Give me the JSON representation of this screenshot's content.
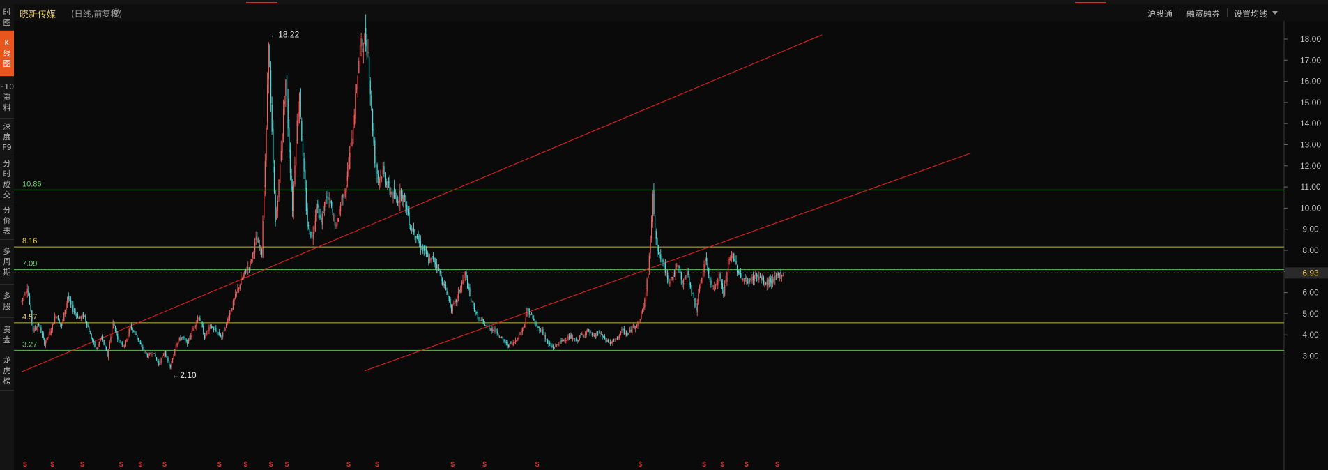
{
  "sidebar": {
    "items": [
      {
        "label": "分时图",
        "chars": [
          "时",
          "图"
        ]
      },
      {
        "label": "K线图",
        "chars": [
          "K",
          "线",
          "图"
        ],
        "active": true
      },
      {
        "label": "F10资料",
        "chars": [
          "F10",
          "资",
          "料"
        ]
      },
      {
        "label": "深度F9",
        "chars": [
          "深",
          "度",
          "F9"
        ]
      },
      {
        "label": "分时成交",
        "chars": [
          "分",
          "时",
          "成",
          "交"
        ]
      },
      {
        "label": "分价表",
        "chars": [
          "分",
          "价",
          "表"
        ]
      },
      {
        "label": "多周期",
        "chars": [
          "多",
          "周",
          "期"
        ]
      },
      {
        "label": "多股",
        "chars": [
          "多",
          "股"
        ]
      },
      {
        "label": "资金",
        "chars": [
          "资",
          "金"
        ]
      },
      {
        "label": "龙虎榜",
        "chars": [
          "龙",
          "虎",
          "榜"
        ]
      }
    ]
  },
  "header": {
    "title": "晓新传媒",
    "subtitle": "(日线,前复权)",
    "buttons": [
      "沪股通",
      "融资融券",
      "设置均线"
    ],
    "gear_icon": "gear-icon",
    "dropdown_icon": "caret-down-icon"
  },
  "colors": {
    "up": "#f25b5b",
    "down": "#4fd6d6",
    "trendline": "#e02020",
    "level_green": "#6fd36f",
    "level_yellow": "#e8d24a",
    "price_tag": "#e8c040",
    "axis_text": "#bfbfbf"
  },
  "chart_data": {
    "type": "candlestick",
    "title": "晓新传媒",
    "y_ticks": [
      "18.00",
      "17.00",
      "16.00",
      "15.00",
      "14.00",
      "13.00",
      "12.00",
      "11.00",
      "10.00",
      "9.00",
      "8.00",
      "7.00",
      "6.00",
      "5.00",
      "4.00",
      "3.00"
    ],
    "ylim": [
      2.5,
      18.5
    ],
    "current_price": "6.93",
    "high_label": "18.22",
    "low_label": "2.10",
    "levels": [
      {
        "value": 10.86,
        "label": "10.86",
        "color": "green"
      },
      {
        "value": 8.16,
        "label": "8.16",
        "color": "yellow"
      },
      {
        "value": 7.09,
        "label": "7.09",
        "color": "green"
      },
      {
        "value": 4.57,
        "label": "4.57",
        "color": "yellow"
      },
      {
        "value": 3.27,
        "label": "3.27",
        "color": "green"
      }
    ],
    "trendlines": [
      {
        "from_index": 0,
        "from_price": 2.25,
        "to_index": 700,
        "to_price": 18.2
      },
      {
        "from_index": 300,
        "from_price": 2.3,
        "to_index": 830,
        "to_price": 12.6
      }
    ],
    "price_path": [
      [
        0,
        5.6
      ],
      [
        5,
        6.3
      ],
      [
        10,
        4.2
      ],
      [
        15,
        4.5
      ],
      [
        20,
        3.6
      ],
      [
        25,
        4.1
      ],
      [
        30,
        5.0
      ],
      [
        35,
        4.4
      ],
      [
        40,
        5.8
      ],
      [
        45,
        5.2
      ],
      [
        50,
        4.8
      ],
      [
        55,
        4.9
      ],
      [
        60,
        4.0
      ],
      [
        65,
        3.3
      ],
      [
        70,
        3.9
      ],
      [
        75,
        3.0
      ],
      [
        80,
        4.6
      ],
      [
        85,
        3.7
      ],
      [
        90,
        3.5
      ],
      [
        95,
        4.4
      ],
      [
        100,
        4.0
      ],
      [
        105,
        3.4
      ],
      [
        110,
        3.0
      ],
      [
        115,
        3.2
      ],
      [
        120,
        2.6
      ],
      [
        125,
        3.2
      ],
      [
        130,
        2.4
      ],
      [
        135,
        3.6
      ],
      [
        140,
        3.9
      ],
      [
        145,
        3.6
      ],
      [
        150,
        4.3
      ],
      [
        155,
        4.9
      ],
      [
        160,
        3.9
      ],
      [
        165,
        4.4
      ],
      [
        170,
        4.2
      ],
      [
        175,
        3.9
      ],
      [
        180,
        4.7
      ],
      [
        185,
        5.5
      ],
      [
        190,
        6.3
      ],
      [
        195,
        6.9
      ],
      [
        200,
        7.4
      ],
      [
        205,
        8.5
      ],
      [
        210,
        7.9
      ],
      [
        212,
        11.0
      ],
      [
        214,
        13.6
      ],
      [
        216,
        18.2
      ],
      [
        218,
        14.8
      ],
      [
        220,
        12.0
      ],
      [
        222,
        9.3
      ],
      [
        225,
        11.2
      ],
      [
        228,
        13.7
      ],
      [
        231,
        16.1
      ],
      [
        234,
        12.8
      ],
      [
        237,
        10.0
      ],
      [
        240,
        13.3
      ],
      [
        243,
        15.5
      ],
      [
        246,
        12.3
      ],
      [
        250,
        9.2
      ],
      [
        254,
        8.6
      ],
      [
        258,
        10.2
      ],
      [
        262,
        9.3
      ],
      [
        266,
        10.5
      ],
      [
        270,
        10.2
      ],
      [
        275,
        9.1
      ],
      [
        280,
        10.5
      ],
      [
        284,
        11.2
      ],
      [
        288,
        12.9
      ],
      [
        292,
        15.2
      ],
      [
        296,
        17.6
      ],
      [
        300,
        18.0
      ],
      [
        303,
        17.4
      ],
      [
        306,
        14.6
      ],
      [
        309,
        12.3
      ],
      [
        312,
        11.4
      ],
      [
        316,
        11.7
      ],
      [
        320,
        11.1
      ],
      [
        324,
        10.7
      ],
      [
        328,
        10.3
      ],
      [
        332,
        10.8
      ],
      [
        336,
        10.2
      ],
      [
        340,
        9.1
      ],
      [
        344,
        8.9
      ],
      [
        348,
        8.3
      ],
      [
        352,
        8.0
      ],
      [
        356,
        7.5
      ],
      [
        360,
        7.6
      ],
      [
        364,
        7.2
      ],
      [
        368,
        6.5
      ],
      [
        372,
        6.0
      ],
      [
        376,
        5.2
      ],
      [
        380,
        5.6
      ],
      [
        384,
        6.3
      ],
      [
        388,
        6.9
      ],
      [
        392,
        5.8
      ],
      [
        396,
        5.2
      ],
      [
        400,
        4.7
      ],
      [
        405,
        4.5
      ],
      [
        410,
        4.3
      ],
      [
        415,
        4.2
      ],
      [
        420,
        3.8
      ],
      [
        425,
        3.5
      ],
      [
        430,
        3.6
      ],
      [
        435,
        4.0
      ],
      [
        440,
        4.5
      ],
      [
        442,
        5.2
      ],
      [
        446,
        4.9
      ],
      [
        450,
        4.4
      ],
      [
        455,
        4.2
      ],
      [
        460,
        3.6
      ],
      [
        465,
        3.4
      ],
      [
        470,
        3.6
      ],
      [
        475,
        3.8
      ],
      [
        480,
        3.9
      ],
      [
        485,
        3.7
      ],
      [
        490,
        4.0
      ],
      [
        495,
        4.2
      ],
      [
        500,
        3.9
      ],
      [
        505,
        4.1
      ],
      [
        510,
        3.8
      ],
      [
        515,
        3.6
      ],
      [
        520,
        3.8
      ],
      [
        525,
        4.2
      ],
      [
        530,
        4.0
      ],
      [
        535,
        4.4
      ],
      [
        540,
        4.6
      ],
      [
        545,
        5.6
      ],
      [
        548,
        7.0
      ],
      [
        550,
        8.5
      ],
      [
        552,
        10.5
      ],
      [
        554,
        9.2
      ],
      [
        556,
        8.1
      ],
      [
        558,
        7.7
      ],
      [
        562,
        7.2
      ],
      [
        566,
        6.6
      ],
      [
        570,
        6.8
      ],
      [
        574,
        7.3
      ],
      [
        578,
        6.4
      ],
      [
        582,
        6.9
      ],
      [
        586,
        6.1
      ],
      [
        590,
        5.2
      ],
      [
        594,
        6.5
      ],
      [
        598,
        7.6
      ],
      [
        602,
        6.6
      ],
      [
        606,
        6.2
      ],
      [
        610,
        6.8
      ],
      [
        614,
        5.9
      ],
      [
        618,
        7.4
      ],
      [
        622,
        7.8
      ],
      [
        626,
        7.1
      ],
      [
        630,
        6.7
      ],
      [
        634,
        6.5
      ],
      [
        638,
        6.6
      ],
      [
        642,
        6.8
      ],
      [
        646,
        6.7
      ],
      [
        650,
        6.4
      ],
      [
        654,
        6.5
      ],
      [
        658,
        6.6
      ],
      [
        662,
        6.8
      ],
      [
        666,
        6.9
      ]
    ],
    "dividend_markers": [
      3,
      27,
      53,
      87,
      104,
      125,
      173,
      196,
      218,
      232,
      286,
      311,
      377,
      405,
      451,
      541,
      597,
      613,
      634,
      661
    ]
  }
}
